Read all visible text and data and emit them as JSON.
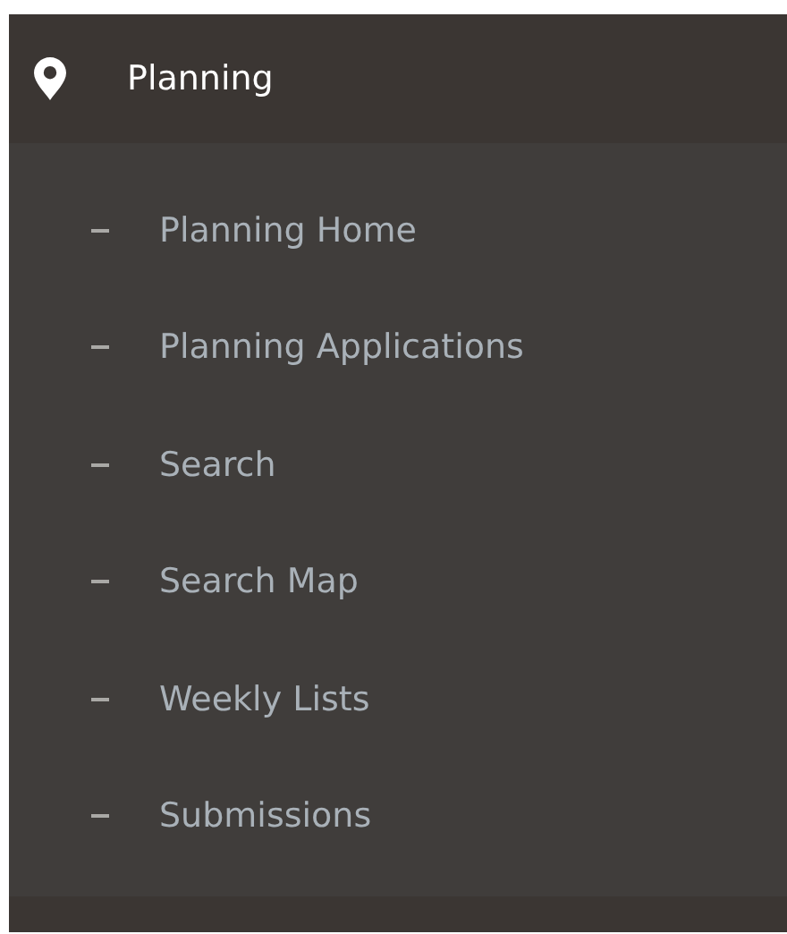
{
  "menu": {
    "title": "Planning",
    "items": [
      {
        "label": "Planning Home"
      },
      {
        "label": "Planning Applications"
      },
      {
        "label": "Search"
      },
      {
        "label": "Search Map"
      },
      {
        "label": "Weekly Lists"
      },
      {
        "label": "Submissions"
      }
    ]
  }
}
